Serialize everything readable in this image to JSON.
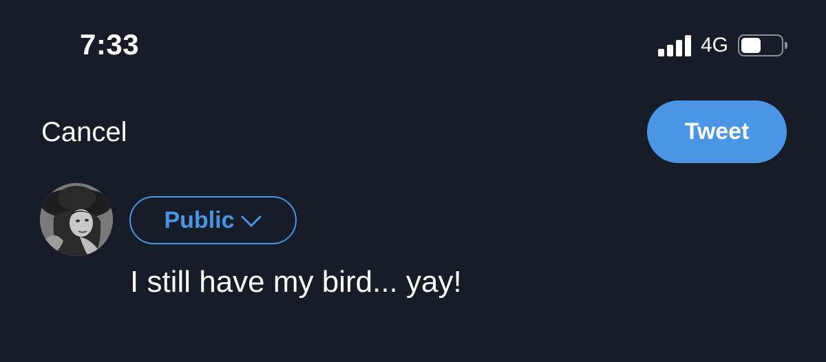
{
  "status_bar": {
    "time": "7:33",
    "network": "4G",
    "signal_bars": 4,
    "battery_level": 0.5
  },
  "composer": {
    "cancel_label": "Cancel",
    "tweet_label": "Tweet",
    "audience_label": "Public",
    "audience_icon": "chevron-down-icon",
    "text": "I still have my bird... yay!"
  },
  "colors": {
    "background": "#161d29",
    "accent": "#4a96e4",
    "text": "#ffffff"
  }
}
